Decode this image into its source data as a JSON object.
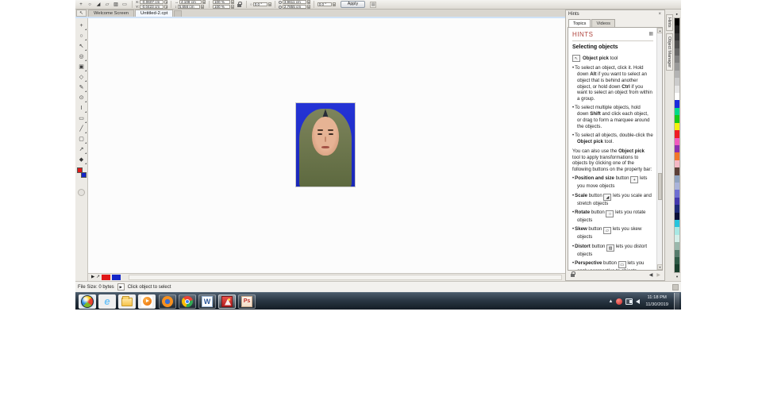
{
  "icons": {
    "tab_tool": "↖",
    "close": "×",
    "grid": "▦",
    "back": "◀",
    "forward": "▶",
    "nav_play": "▶",
    "dropper": "↗",
    "scroll_up": "▲",
    "scroll_down": "▼",
    "palette_flyout_top": "▸",
    "palette_flyout_bottom": "▾",
    "tray_up": "▲",
    "status_play": "▶",
    "propbar_end": "▤",
    "bullet": "•"
  },
  "propbar": {
    "transform_tools": [
      {
        "name": "position-size-button",
        "glyph": "+"
      },
      {
        "name": "rotate-button",
        "glyph": "○"
      },
      {
        "name": "scale-button",
        "glyph": "◢"
      },
      {
        "name": "skew-button",
        "glyph": "▱"
      },
      {
        "name": "distort-button",
        "glyph": "▨"
      },
      {
        "name": "perspective-button",
        "glyph": "▭"
      }
    ],
    "x_label": "X:",
    "x_value": "-0.0607 cm",
    "y_label": "Y:",
    "y_value": "-0.0423 cm",
    "w_label": "↔",
    "w_value": "4.108 cm",
    "h_label": "↕",
    "h_value": "5.656 cm",
    "sx_value": "100 %",
    "sy_value": "100 %",
    "angle_label": "○",
    "angle_value": "0.0 °",
    "dim1_value": "3.9611 cm",
    "dim2_value": "2.7855 cm",
    "angle2_value": "0.0 °",
    "apply_label": "Apply"
  },
  "doctabs": {
    "items": [
      {
        "label": "Welcome Screen",
        "cls": ""
      },
      {
        "label": "Untitled-2.cpt",
        "cls": "active"
      }
    ]
  },
  "toolbox": {
    "tools": [
      {
        "name": "object-pick-tool",
        "glyph": "+"
      },
      {
        "name": "mask-tool",
        "glyph": "○"
      },
      {
        "name": "mask-transform-tool",
        "glyph": "↖"
      },
      {
        "name": "zoom-tool",
        "glyph": "◎"
      },
      {
        "name": "crop-tool",
        "glyph": "▣"
      },
      {
        "name": "eraser-tool",
        "glyph": "◇"
      },
      {
        "name": "touch-up-brush-tool",
        "glyph": "✎"
      },
      {
        "name": "clone-tool",
        "glyph": "⊙"
      },
      {
        "name": "text-tool",
        "glyph": "I"
      },
      {
        "name": "shape-tool",
        "glyph": "▭"
      },
      {
        "name": "paint-tool",
        "glyph": "╱"
      },
      {
        "name": "rectangle-tool",
        "glyph": "▢"
      },
      {
        "name": "eyedropper-tool",
        "glyph": "↗"
      },
      {
        "name": "fill-tool",
        "glyph": "◆"
      }
    ],
    "foreground_color": "#e01818",
    "background_color": "#1426c8"
  },
  "hints": {
    "title": "Hints",
    "tabs": [
      {
        "label": "Topics",
        "cls": "active"
      },
      {
        "label": "Videos",
        "cls": ""
      }
    ],
    "header": "HINTS",
    "section_title": "Selecting objects",
    "tool_icon": "↖",
    "tool_line": [
      {
        "t": "Object pick",
        "b": 1
      },
      {
        "t": " tool"
      }
    ],
    "bullets": [
      [
        {
          "t": "To select an object, click it. Hold down "
        },
        {
          "t": "Alt",
          "b": 1
        },
        {
          "t": " if you want to select an object that is behind another object, or hold down "
        },
        {
          "t": "Ctrl",
          "b": 1
        },
        {
          "t": " if you want to select an object from within a group."
        }
      ],
      [
        {
          "t": "To select multiple objects, hold down "
        },
        {
          "t": "Shift",
          "b": 1
        },
        {
          "t": " and click each object, or drag to form a marquee around the objects."
        }
      ],
      [
        {
          "t": "To select all objects, double-click the "
        },
        {
          "t": "Object pick",
          "b": 1
        },
        {
          "t": " tool."
        }
      ]
    ],
    "paragraph": [
      {
        "t": "You can also use the "
      },
      {
        "t": "Object pick",
        "b": 1
      },
      {
        "t": " tool to apply transformations to objects by clicking one of the following buttons on the property bar:"
      }
    ],
    "buttons": [
      {
        "pre": [
          {
            "t": "Position and size",
            "b": 1
          },
          {
            "t": " button "
          }
        ],
        "glyph": "+",
        "post": " lets you move objects"
      },
      {
        "pre": [
          {
            "t": "Scale",
            "b": 1
          },
          {
            "t": " button "
          }
        ],
        "glyph": "◢",
        "post": " lets you scale and stretch objects"
      },
      {
        "pre": [
          {
            "t": "Rotate",
            "b": 1
          },
          {
            "t": " button "
          }
        ],
        "glyph": "○",
        "post": " lets you rotate objects"
      },
      {
        "pre": [
          {
            "t": "Skew",
            "b": 1
          },
          {
            "t": " button "
          }
        ],
        "glyph": "▱",
        "post": " lets you skew objects"
      },
      {
        "pre": [
          {
            "t": "Distort",
            "b": 1
          },
          {
            "t": " button "
          }
        ],
        "glyph": "▨",
        "post": " lets you distort objects"
      },
      {
        "pre": [
          {
            "t": "Perspective",
            "b": 1
          },
          {
            "t": " button "
          }
        ],
        "glyph": "▭",
        "post": " lets you apply perspective to objects"
      }
    ]
  },
  "right_strip": {
    "vertical_tabs": [
      {
        "label": "Hints",
        "name": "vtab-hints"
      },
      {
        "label": "Object Manager",
        "name": "vtab-object-manager"
      }
    ],
    "palette_colors": [
      "#000000",
      "#1c1c1c",
      "#333333",
      "#4d4d4d",
      "#666666",
      "#808080",
      "#999999",
      "#b3b3b3",
      "#cccccc",
      "#e6e6e6",
      "#ffffff",
      "#1a2bdc",
      "#00d98a",
      "#17c917",
      "#f4ef0e",
      "#ee1c24",
      "#f05bbd",
      "#8a2fae",
      "#f2772a",
      "#f5b8c4",
      "#5d4037",
      "#8fa3c0",
      "#aab4da",
      "#6f6fd2",
      "#4338ae",
      "#1d2a78",
      "#0b1038",
      "#27c4dd",
      "#a8e8e4",
      "#d4efe9",
      "#9ab8ac",
      "#567b6c",
      "#2e5a46",
      "#183f2c"
    ]
  },
  "statusbar": {
    "file_size": "File Size: 0 bytes",
    "message": "Click object to select"
  },
  "taskbar": {
    "pinned": [
      {
        "cls": "ic-start",
        "name": "start-button"
      },
      {
        "cls": "ic-ie",
        "name": "internet-explorer-icon",
        "glyph": "e"
      },
      {
        "cls": "ic-folder",
        "name": "file-explorer-icon"
      },
      {
        "cls": "ic-wmp",
        "name": "media-player-icon"
      }
    ],
    "running": [
      {
        "cls": "ic-firefox",
        "name": "firefox-icon",
        "box": ""
      },
      {
        "cls": "ic-chrome",
        "name": "chrome-icon",
        "box": ""
      },
      {
        "cls": "ic-word",
        "name": "word-icon",
        "glyph": "W",
        "box": ""
      },
      {
        "cls": "ic-red",
        "name": "red-app-icon",
        "box": "active"
      },
      {
        "cls": "ic-ps",
        "name": "ps-app-icon",
        "glyph": "Ps",
        "box": ""
      }
    ],
    "tray": {
      "time": "11:18 PM",
      "date": "11/30/2019"
    }
  }
}
